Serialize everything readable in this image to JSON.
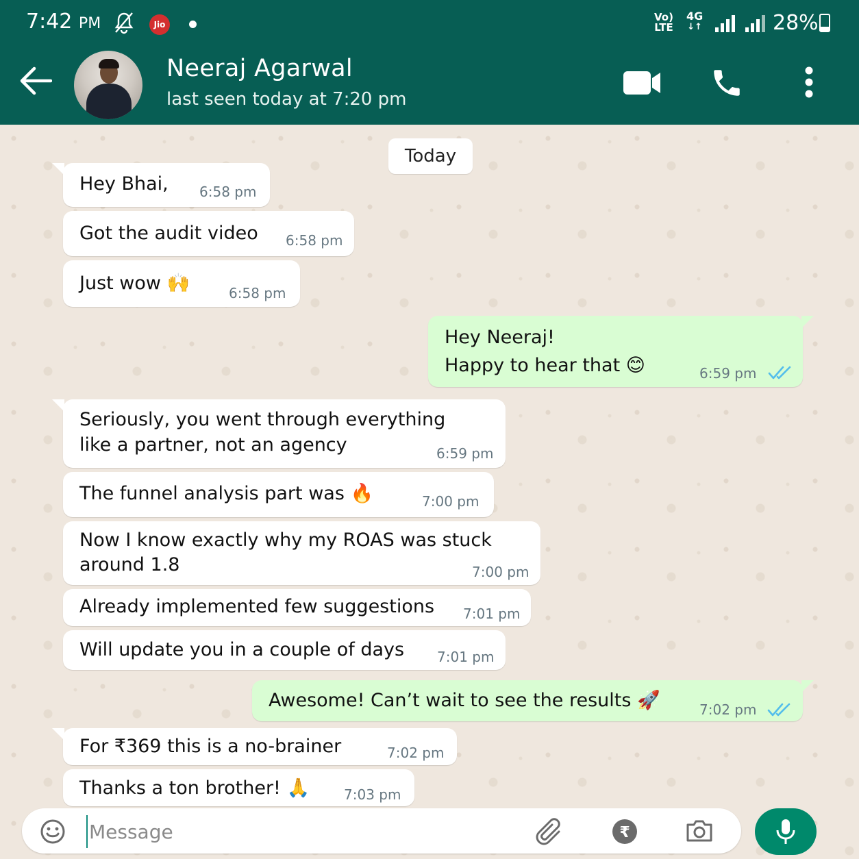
{
  "status_bar": {
    "time": "7:42",
    "ampm": "PM",
    "carrier_badge": "Jio",
    "volte_top": "Vo)",
    "volte_bottom": "LTE",
    "network": "4G",
    "battery": "28%",
    "battery_level": 0.28
  },
  "header": {
    "contact_name": "Neeraj Agarwal",
    "last_seen": "last seen today at 7:20 pm",
    "icons": [
      "back-arrow-icon",
      "video-call-icon",
      "phone-icon",
      "more-vert-icon"
    ]
  },
  "chat": {
    "date_chip": "Today",
    "messages": [
      {
        "dir": "in",
        "text": "Hey Bhai,",
        "time": "6:58 pm"
      },
      {
        "dir": "in",
        "text": "Got the audit video",
        "time": "6:58 pm"
      },
      {
        "dir": "in",
        "text": "Just wow 🙌",
        "time": "6:58 pm"
      },
      {
        "dir": "out",
        "text": "Hey Neeraj!\nHappy to hear that 😊",
        "time": "6:59 pm",
        "read": true
      },
      {
        "dir": "in",
        "text": "Seriously, you went through everything\nlike a partner, not an agency",
        "time": "6:59 pm"
      },
      {
        "dir": "in",
        "text": "The funnel analysis part was 🔥",
        "time": "7:00 pm"
      },
      {
        "dir": "in",
        "text": "Now I know exactly why my ROAS was stuck\naround 1.8",
        "time": "7:00 pm"
      },
      {
        "dir": "in",
        "text": "Already implemented few suggestions",
        "time": "7:01 pm"
      },
      {
        "dir": "in",
        "text": "Will update you in a couple of days",
        "time": "7:01 pm"
      },
      {
        "dir": "out",
        "text": "Awesome! Can’t wait to see the results 🚀",
        "time": "7:02 pm",
        "read": true
      },
      {
        "dir": "in",
        "text": "For ₹369 this is a no-brainer",
        "time": "7:02 pm"
      },
      {
        "dir": "in",
        "text": "Thanks a ton brother! 🙏",
        "time": "7:03 pm"
      }
    ]
  },
  "composer": {
    "placeholder": "Message",
    "icons": [
      "emoji-icon",
      "attach-icon",
      "rupee-payment-icon",
      "camera-icon",
      "mic-icon"
    ]
  },
  "colors": {
    "header_bg": "#075e54",
    "outgoing_bubble": "#d9fdd3",
    "incoming_bubble": "#ffffff",
    "read_ticks": "#53bdeb",
    "mic_button": "#00896b"
  }
}
